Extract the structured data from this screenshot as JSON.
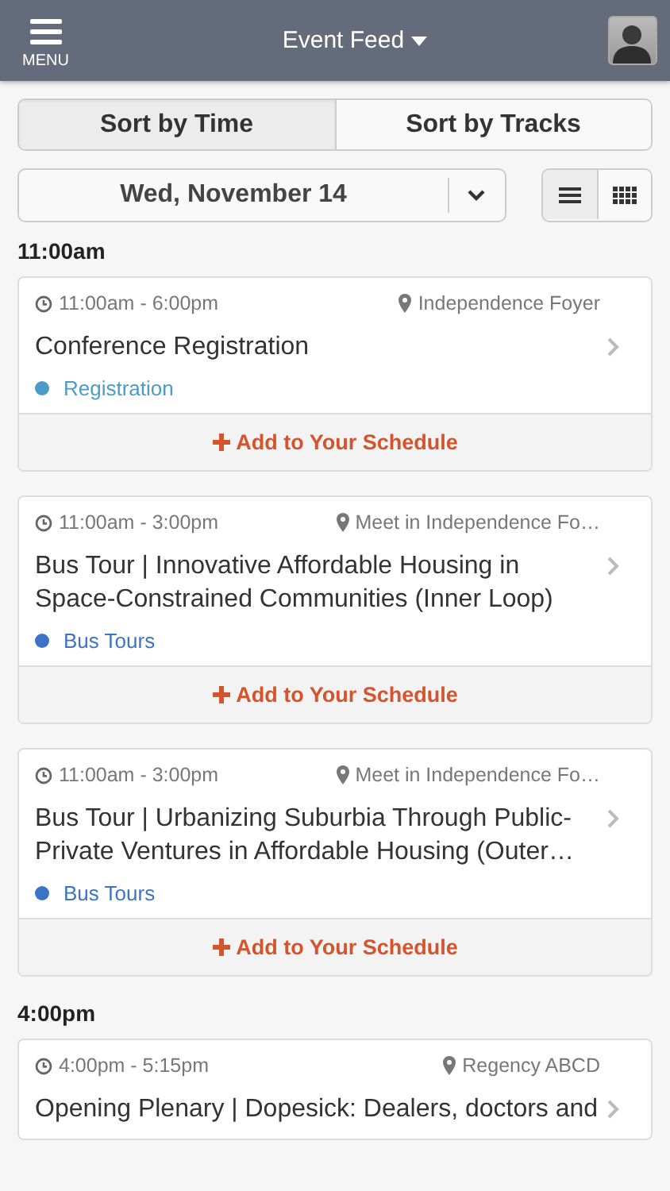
{
  "header": {
    "menu_label": "MENU",
    "title": "Event Feed"
  },
  "sort_tabs": [
    {
      "label": "Sort by Time",
      "selected": true
    },
    {
      "label": "Sort by Tracks",
      "selected": false
    }
  ],
  "date_picker": {
    "value": "Wed, November 14"
  },
  "view_toggle": [
    {
      "kind": "list",
      "selected": true
    },
    {
      "kind": "grid",
      "selected": false
    }
  ],
  "sections": [
    {
      "time": "11:00am",
      "events": [
        {
          "time_range": "11:00am - 6:00pm",
          "location": "Independence Foyer",
          "title": "Conference Registration",
          "track": {
            "name": "Registration",
            "color": "#4b9bc8"
          },
          "add_label": "Add to Your Schedule"
        },
        {
          "time_range": "11:00am - 3:00pm",
          "location": "Meet in Independence Fo…",
          "title": "Bus Tour | Innovative Affordable Housing in Space-Constrained Communities (Inner Loop)",
          "track": {
            "name": "Bus Tours",
            "color": "#3b74c6"
          },
          "add_label": "Add to Your Schedule"
        },
        {
          "time_range": "11:00am - 3:00pm",
          "location": "Meet in Independence Fo…",
          "title": "Bus Tour | Urbanizing Suburbia Through Public-Private Ventures in Affordable Housing (Outer…",
          "track": {
            "name": "Bus Tours",
            "color": "#3b74c6"
          },
          "add_label": "Add to Your Schedule"
        }
      ]
    },
    {
      "time": "4:00pm",
      "events": [
        {
          "time_range": "4:00pm - 5:15pm",
          "location": "Regency ABCD",
          "title": "Opening Plenary | Dopesick: Dealers, doctors and"
        }
      ]
    }
  ]
}
